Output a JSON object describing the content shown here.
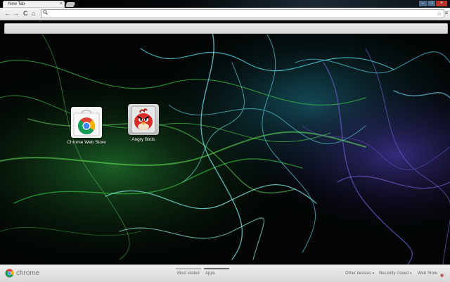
{
  "tab": {
    "title": "New Tab",
    "close": "×"
  },
  "window_controls": {
    "minimize": "–",
    "maximize": "□",
    "close": "×"
  },
  "toolbar": {
    "back": "←",
    "forward": "→",
    "reload": "C",
    "home": "⌂",
    "search_glyph": "🔍︎",
    "omnibox_value": "",
    "star": "☆",
    "menu": "≡"
  },
  "apps": [
    {
      "label": "Chrome Web Store",
      "icon": "chrome-web-store-icon"
    },
    {
      "label": "Angry Birds",
      "icon": "angry-birds-icon"
    }
  ],
  "footer": {
    "logo_text": "chrome",
    "sections": [
      {
        "label": "Most visited",
        "active": false
      },
      {
        "label": "Apps",
        "active": true
      }
    ],
    "other_devices": "Other devices",
    "recently_closed": "Recently closed",
    "web_store": "Web Store",
    "caret": "▾"
  },
  "colors": {
    "chrome_red": "#db4437",
    "chrome_green": "#0f9d58",
    "chrome_yellow": "#f4b400",
    "chrome_blue": "#4285f4"
  }
}
